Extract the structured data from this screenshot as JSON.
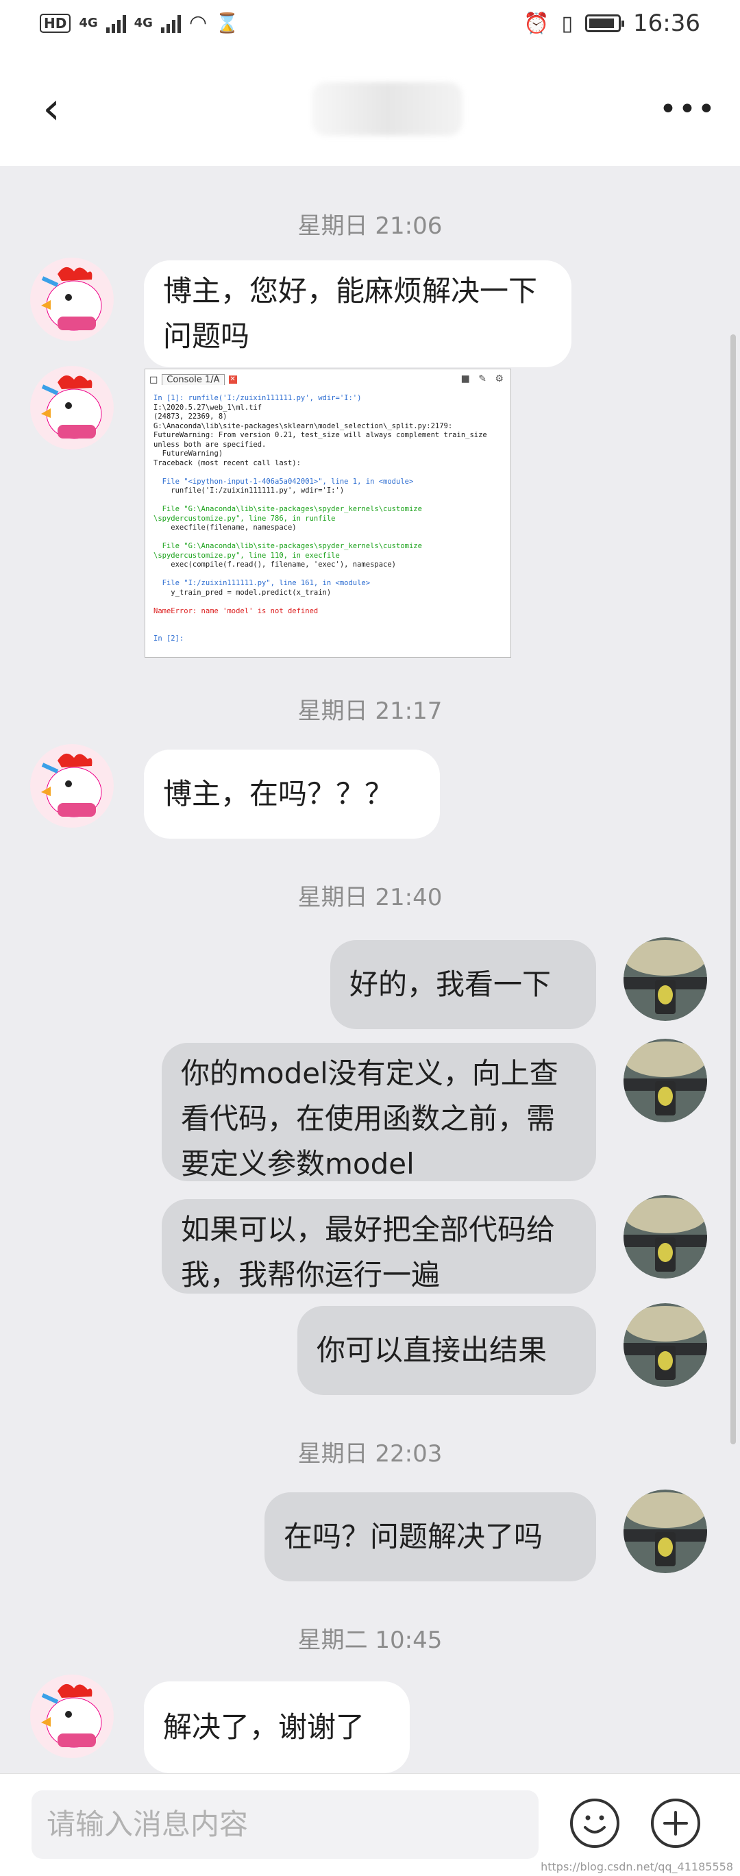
{
  "status_bar": {
    "left_badges": [
      "HD",
      "4G",
      "4G"
    ],
    "time": "16:36"
  },
  "header": {
    "back_icon": "chevron-left-icon",
    "title": "yus         yu",
    "more_icon": "more-icon"
  },
  "messages": [
    {
      "type": "time",
      "text": "星期日 21:06"
    },
    {
      "type": "incoming",
      "text": "博主，您好，能麻烦解决一下问题吗"
    },
    {
      "type": "incoming-image"
    },
    {
      "type": "time",
      "text": "星期日 21:17"
    },
    {
      "type": "incoming",
      "text": "博主，在吗？？？"
    },
    {
      "type": "time",
      "text": "星期日 21:40"
    },
    {
      "type": "outgoing",
      "text": "好的，我看一下"
    },
    {
      "type": "outgoing",
      "text": "你的model没有定义，向上查看代码，在使用函数之前，需要定义参数model"
    },
    {
      "type": "outgoing",
      "text": "如果可以，最好把全部代码给我，我帮你运行一遍"
    },
    {
      "type": "outgoing",
      "text": "你可以直接出结果"
    },
    {
      "type": "time",
      "text": "星期日 22:03"
    },
    {
      "type": "outgoing",
      "text": "在吗？问题解决了吗"
    },
    {
      "type": "time",
      "text": "星期二 10:45"
    },
    {
      "type": "incoming",
      "text": "解决了，谢谢了"
    }
  ],
  "shared_screenshot": {
    "tab_label": "Console 1/A",
    "lines": [
      "In [1]: runfile('I:/zuixin111111.py', wdir='I:')",
      "I:\\2020.5.27\\web_1\\ml.tif",
      "(24873, 22369, 8)",
      "G:\\Anaconda\\lib\\site-packages\\sklearn\\model_selection\\_split.py:2179:",
      "FutureWarning: From version 0.21, test_size will always complement train_size",
      "unless both are specified.",
      "  FutureWarning)",
      "Traceback (most recent call last):",
      "",
      "  File \"<ipython-input-1-406a5a042001>\", line 1, in <module>",
      "    runfile('I:/zuixin111111.py', wdir='I:')",
      "",
      "  File \"G:\\Anaconda\\lib\\site-packages\\spyder_kernels\\customize",
      "\\spydercustomize.py\", line 786, in runfile",
      "    execfile(filename, namespace)",
      "",
      "  File \"G:\\Anaconda\\lib\\site-packages\\spyder_kernels\\customize",
      "\\spydercustomize.py\", line 110, in execfile",
      "    exec(compile(f.read(), filename, 'exec'), namespace)",
      "",
      "  File \"I:/zuixin111111.py\", line 161, in <module>",
      "    y_train_pred = model.predict(x_train)",
      "",
      "NameError: name 'model' is not defined",
      "",
      "",
      "In [2]:"
    ]
  },
  "input_bar": {
    "placeholder": "请输入消息内容",
    "emoji_icon": "emoji-icon",
    "plus_icon": "plus-icon"
  },
  "watermark": "https://blog.csdn.net/qq_41185558"
}
